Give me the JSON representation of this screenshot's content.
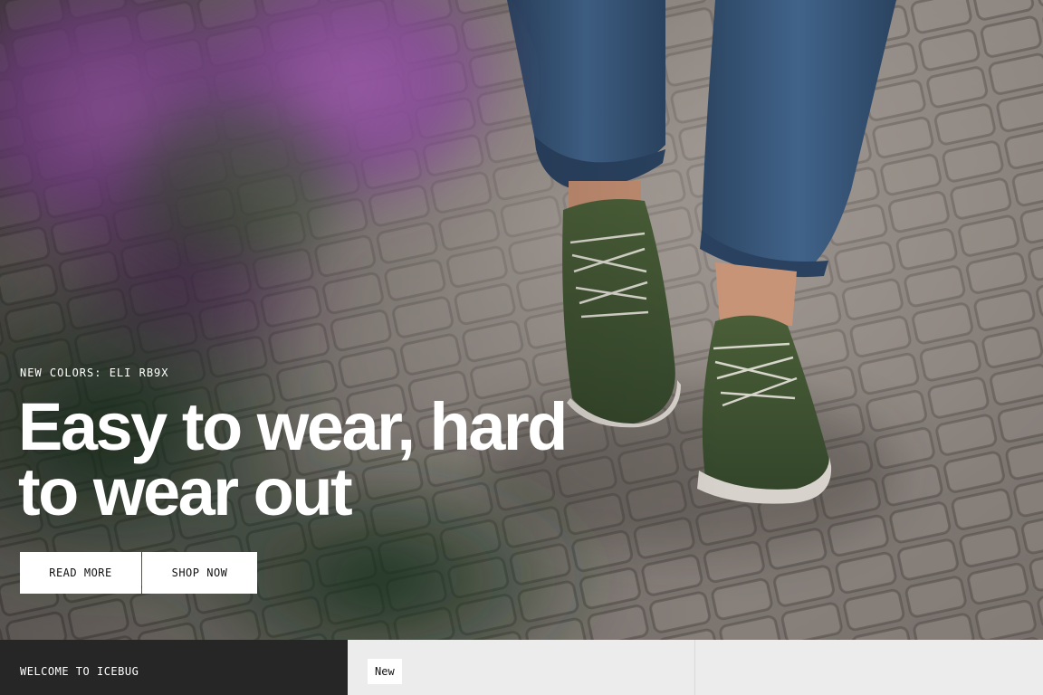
{
  "hero": {
    "eyebrow": "NEW COLORS: ELI RB9X",
    "title_line1": "Easy to wear, hard",
    "title_line2": "to wear out",
    "buttons": {
      "read_more": "READ MORE",
      "shop_now": "SHOP NOW"
    },
    "image": {
      "description_icon": "hero-photo-icon",
      "colors": {
        "shoe": "#3f5131",
        "denim": "#34506f",
        "flower": "#a35bb2",
        "cobble": "#8a837e"
      }
    }
  },
  "strip": {
    "welcome": "WELCOME TO ICEBUG",
    "card1_badge": "New"
  }
}
